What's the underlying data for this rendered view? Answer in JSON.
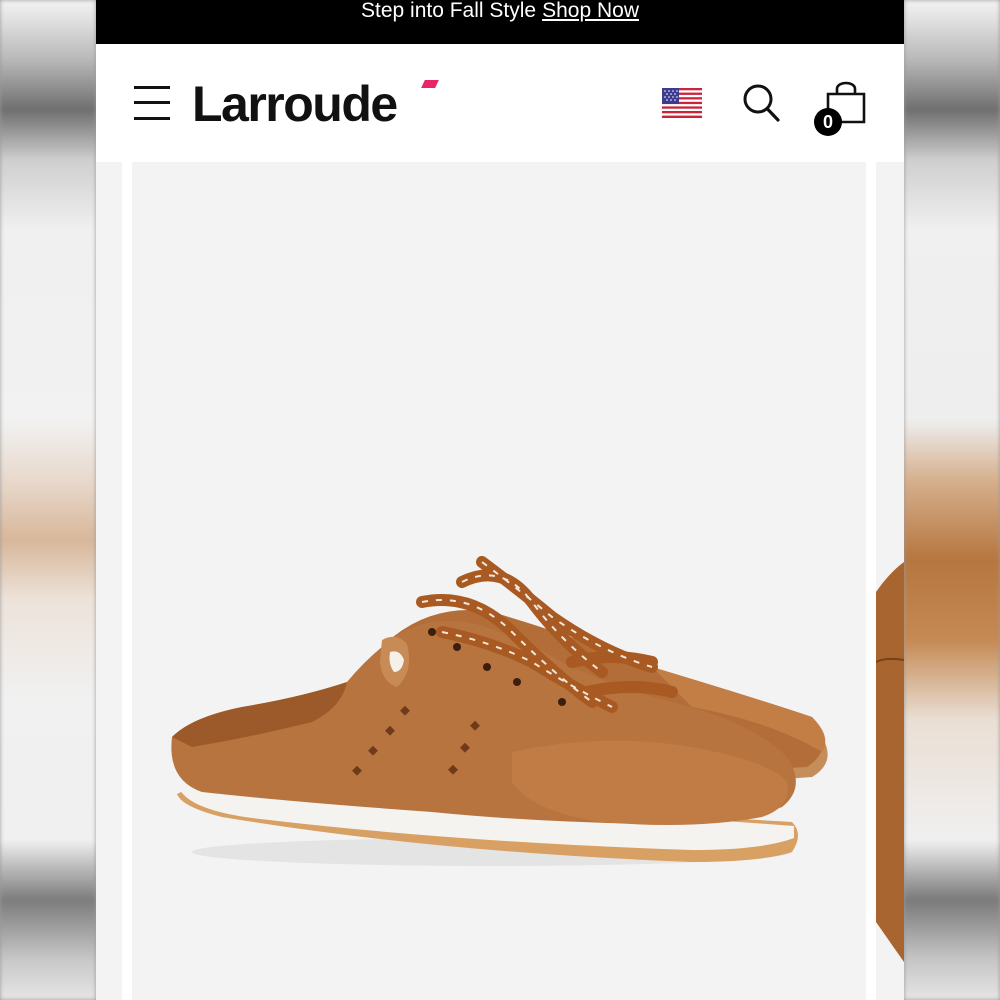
{
  "promo": {
    "text": "Step into Fall Style",
    "link_label": "Shop Now"
  },
  "header": {
    "logo_text": "Larroude",
    "menu_icon": "hamburger-menu-icon",
    "flag_icon": "us-flag-icon",
    "search_icon": "search-icon",
    "bag_icon": "shopping-bag-icon",
    "bag_count": "0"
  },
  "gallery": {
    "main_image": "brown-leather-lace-up-mule-sneaker"
  },
  "colors": {
    "promo_bg": "#000000",
    "logo_accent": "#e8246b",
    "image_bg": "#f3f3f3",
    "leather": "#b8743f"
  }
}
